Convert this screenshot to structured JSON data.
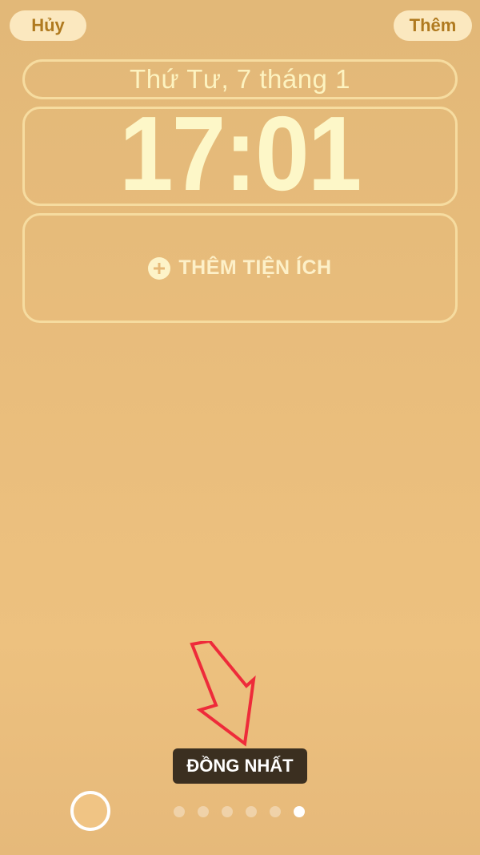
{
  "header": {
    "cancel_label": "Hủy",
    "add_label": "Thêm"
  },
  "lockscreen": {
    "date": "Thứ Tư, 7 tháng 1",
    "time": "17:01",
    "widget_add_label": "THÊM TIỆN ÍCH"
  },
  "style_picker": {
    "current_style": "ĐỒNG NHẤT",
    "page_count": 6,
    "active_page_index": 5
  },
  "colors": {
    "background": "#e9bd7c",
    "accent_text": "#b07a1f",
    "annotation_arrow": "#ee2b3a"
  },
  "icons": {
    "widget_add": "plus-circle-icon",
    "annotation": "arrow-down-icon"
  }
}
